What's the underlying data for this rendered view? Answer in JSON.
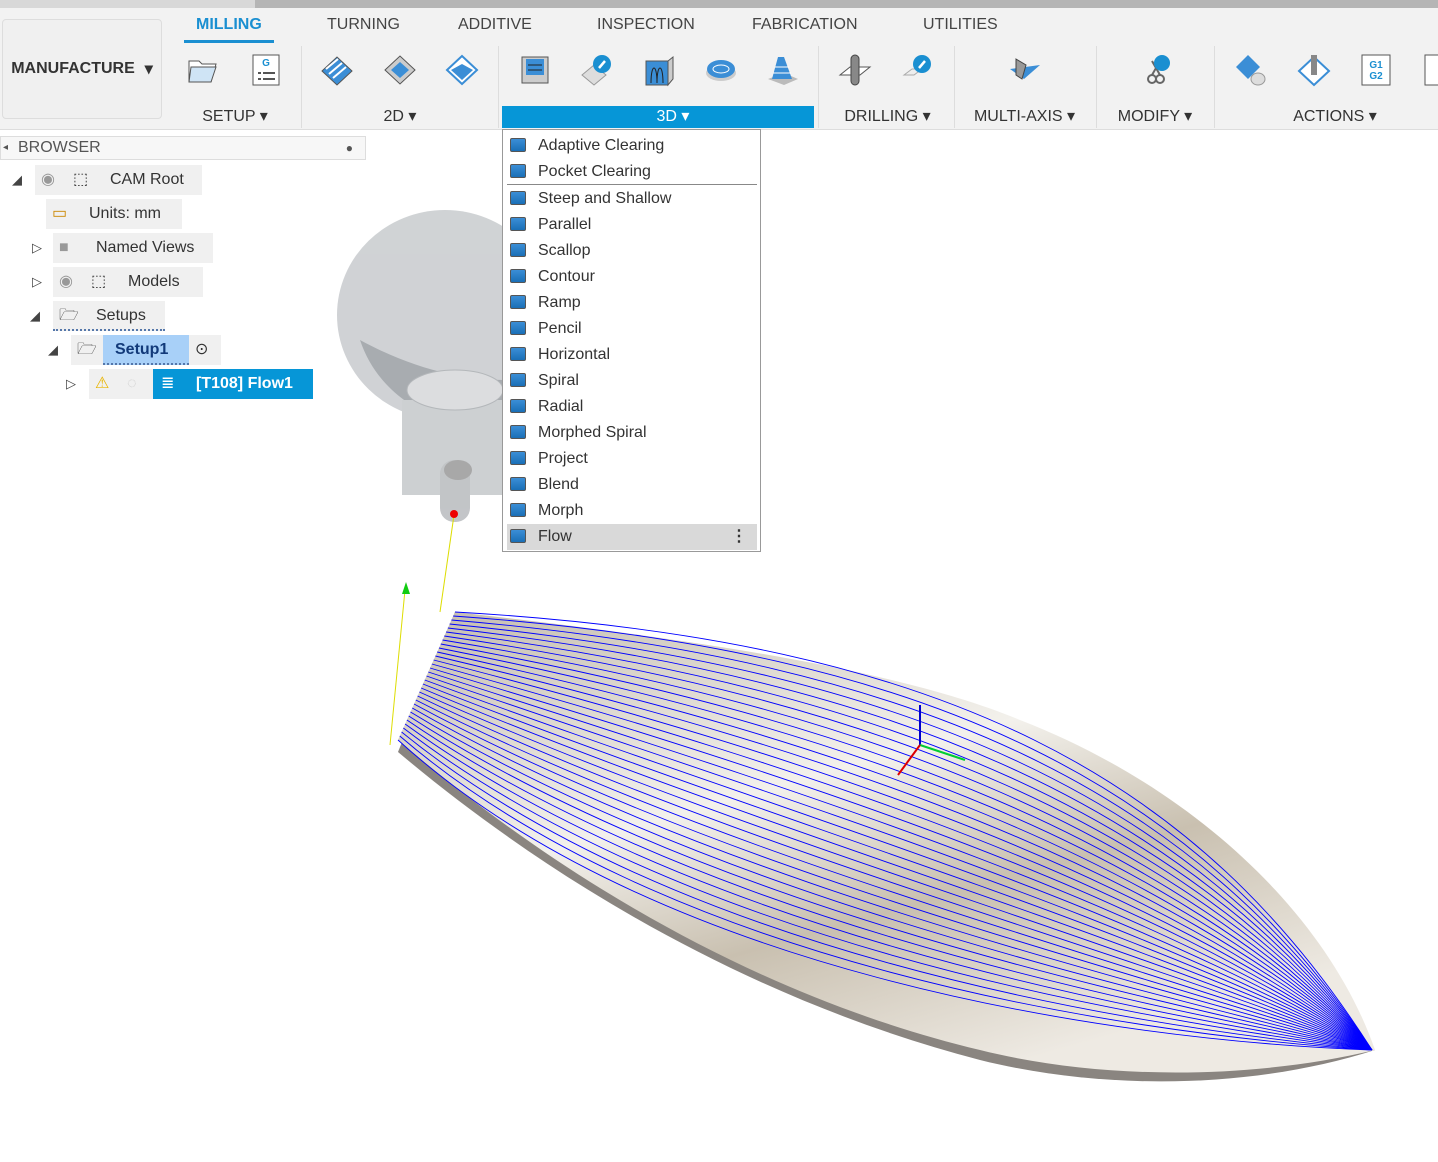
{
  "workspace": {
    "label": "MANUFACTURE"
  },
  "tabs": [
    {
      "label": "MILLING",
      "active": true
    },
    {
      "label": "TURNING"
    },
    {
      "label": "ADDITIVE"
    },
    {
      "label": "INSPECTION"
    },
    {
      "label": "FABRICATION"
    },
    {
      "label": "UTILITIES"
    }
  ],
  "groups": [
    {
      "label": "SETUP"
    },
    {
      "label": "2D"
    },
    {
      "label": "3D",
      "selected": true
    },
    {
      "label": "DRILLING"
    },
    {
      "label": "MULTI-AXIS"
    },
    {
      "label": "MODIFY"
    },
    {
      "label": "ACTIONS"
    }
  ],
  "actions_icon_text": "G1 G2",
  "setup_icon_text": "G",
  "browser": {
    "title": "BROWSER",
    "items": [
      {
        "label": "CAM Root"
      },
      {
        "label": "Units: mm"
      },
      {
        "label": "Named Views"
      },
      {
        "label": "Models"
      },
      {
        "label": "Setups"
      },
      {
        "label": "Setup1"
      },
      {
        "label": "[T108] Flow1",
        "selected": true,
        "warning": true
      }
    ]
  },
  "menu_3d": {
    "items": [
      {
        "label": "Adaptive Clearing",
        "icon": "adaptive-icon"
      },
      {
        "label": "Pocket Clearing",
        "icon": "pocket-icon"
      },
      {
        "label": "Steep and Shallow",
        "icon": "steep-shallow-icon"
      },
      {
        "label": "Parallel",
        "icon": "parallel-icon"
      },
      {
        "label": "Scallop",
        "icon": "scallop-icon"
      },
      {
        "label": "Contour",
        "icon": "contour-icon"
      },
      {
        "label": "Ramp",
        "icon": "ramp-icon"
      },
      {
        "label": "Pencil",
        "icon": "pencil-icon"
      },
      {
        "label": "Horizontal",
        "icon": "horizontal-icon"
      },
      {
        "label": "Spiral",
        "icon": "spiral-icon"
      },
      {
        "label": "Radial",
        "icon": "radial-icon"
      },
      {
        "label": "Morphed Spiral",
        "icon": "morphed-spiral-icon"
      },
      {
        "label": "Project",
        "icon": "project-icon"
      },
      {
        "label": "Blend",
        "icon": "blend-icon"
      },
      {
        "label": "Morph",
        "icon": "morph-icon"
      },
      {
        "label": "Flow",
        "icon": "flow-icon",
        "highlighted": true
      }
    ]
  },
  "colors": {
    "accent": "#0696d7",
    "toolpath": "#0000ff"
  }
}
